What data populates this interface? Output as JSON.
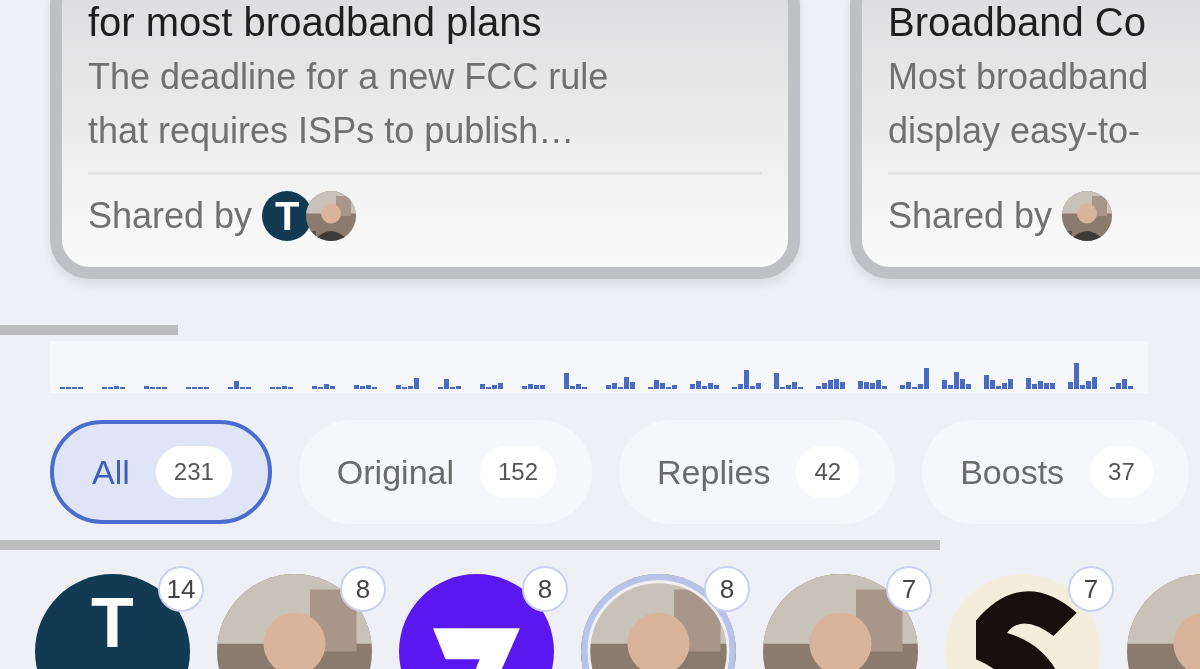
{
  "cards": [
    {
      "title": "for most broadband plans",
      "summary": "The deadline for a new FCC rule that requires ISPs to publish…",
      "shared_by": "Shared by",
      "sharers": [
        {
          "kind": "letter",
          "letter": "T"
        },
        {
          "kind": "picture"
        }
      ]
    },
    {
      "title": "Broadband Co",
      "summary": "Most broadband display easy-to-",
      "shared_by": "Shared by",
      "sharers": [
        {
          "kind": "picture"
        }
      ]
    }
  ],
  "filters": [
    {
      "label": "All",
      "count": "231",
      "selected": true
    },
    {
      "label": "Original",
      "count": "152",
      "selected": false
    },
    {
      "label": "Replies",
      "count": "42",
      "selected": false
    },
    {
      "label": "Boosts",
      "count": "37",
      "selected": false
    }
  ],
  "accounts": [
    {
      "kind": "letter",
      "letter": "T",
      "count": "14",
      "selected": false
    },
    {
      "kind": "picture",
      "count": "8",
      "selected": false
    },
    {
      "kind": "chevron",
      "count": "8",
      "selected": false
    },
    {
      "kind": "picture",
      "count": "8",
      "selected": true
    },
    {
      "kind": "picture",
      "count": "7",
      "selected": false
    },
    {
      "kind": "curve",
      "count": "7",
      "selected": false
    },
    {
      "kind": "picture",
      "selected": false
    }
  ]
}
